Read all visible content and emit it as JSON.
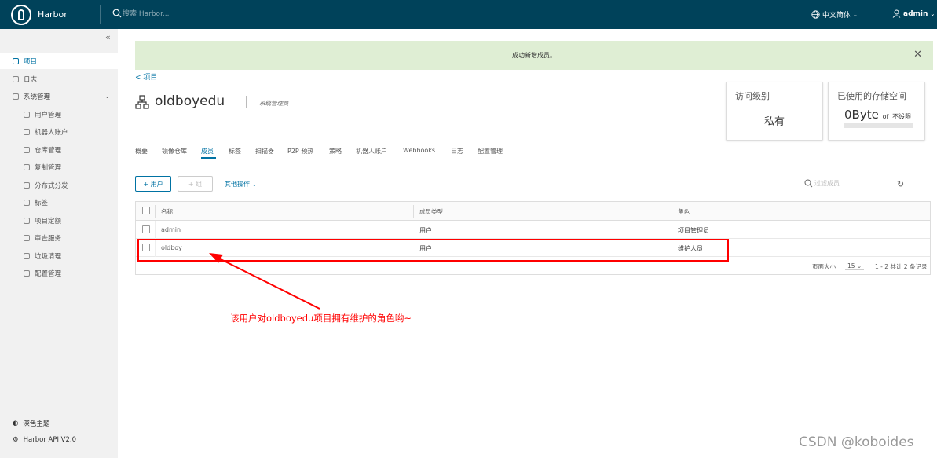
{
  "header": {
    "brand": "Harbor",
    "search_placeholder": "搜索 Harbor...",
    "language": "中文简体",
    "user": "admin"
  },
  "sidebar": {
    "collapse_icon": "double-chevron-left-icon",
    "items": [
      {
        "label": "项目",
        "icon": "project-icon"
      },
      {
        "label": "日志",
        "icon": "log-icon"
      },
      {
        "label": "系统管理",
        "icon": "admin-icon"
      }
    ],
    "sub_items": [
      {
        "label": "用户管理",
        "icon": "users-icon"
      },
      {
        "label": "机器人账户",
        "icon": "robot-icon"
      },
      {
        "label": "仓库管理",
        "icon": "registry-icon"
      },
      {
        "label": "复制管理",
        "icon": "replication-icon"
      },
      {
        "label": "分布式分发",
        "icon": "distribution-icon"
      },
      {
        "label": "标签",
        "icon": "tag-icon"
      },
      {
        "label": "项目定额",
        "icon": "quota-icon"
      },
      {
        "label": "审查服务",
        "icon": "shield-icon"
      },
      {
        "label": "垃圾清理",
        "icon": "trash-icon"
      },
      {
        "label": "配置管理",
        "icon": "gear-icon"
      }
    ],
    "bottom": {
      "theme": "深色主题",
      "api": "Harbor API V2.0"
    }
  },
  "alert": {
    "message": "成功新增成员。"
  },
  "breadcrumb": {
    "back": "项目"
  },
  "project": {
    "name": "oldboyedu",
    "role": "系统管理员"
  },
  "cards": {
    "access_title": "访问级别",
    "access_value": "私有",
    "storage_title": "已使用的存储空间",
    "storage_value": "0Byte",
    "storage_of": "of",
    "storage_limit": "不设限"
  },
  "tabs": [
    {
      "label": "概要"
    },
    {
      "label": "镜像仓库"
    },
    {
      "label": "成员"
    },
    {
      "label": "标签"
    },
    {
      "label": "扫描器"
    },
    {
      "label": "P2P 预热"
    },
    {
      "label": "策略"
    },
    {
      "label": "机器人账户"
    },
    {
      "label": "Webhooks"
    },
    {
      "label": "日志"
    },
    {
      "label": "配置管理"
    }
  ],
  "toolbar": {
    "add_user": "+ 用户",
    "add_group": "+ 组",
    "other_ops": "其他操作",
    "filter_placeholder": "过滤成员"
  },
  "table": {
    "headers": [
      "名称",
      "成员类型",
      "角色"
    ],
    "rows": [
      {
        "name": "admin",
        "type": "用户",
        "role": "项目管理员"
      },
      {
        "name": "oldboy",
        "type": "用户",
        "role": "维护人员"
      }
    ],
    "page_size_label": "页面大小",
    "page_size": "15",
    "summary": "1 - 2 共计 2 条记录"
  },
  "annotation": {
    "text": "该用户对oldboyedu项目拥有维护的角色哟~",
    "color": "#ff0000"
  },
  "watermark": "CSDN @koboides",
  "colors": {
    "header": "#00425a",
    "accent": "#0072a3",
    "success_bg": "#dfeed4"
  }
}
